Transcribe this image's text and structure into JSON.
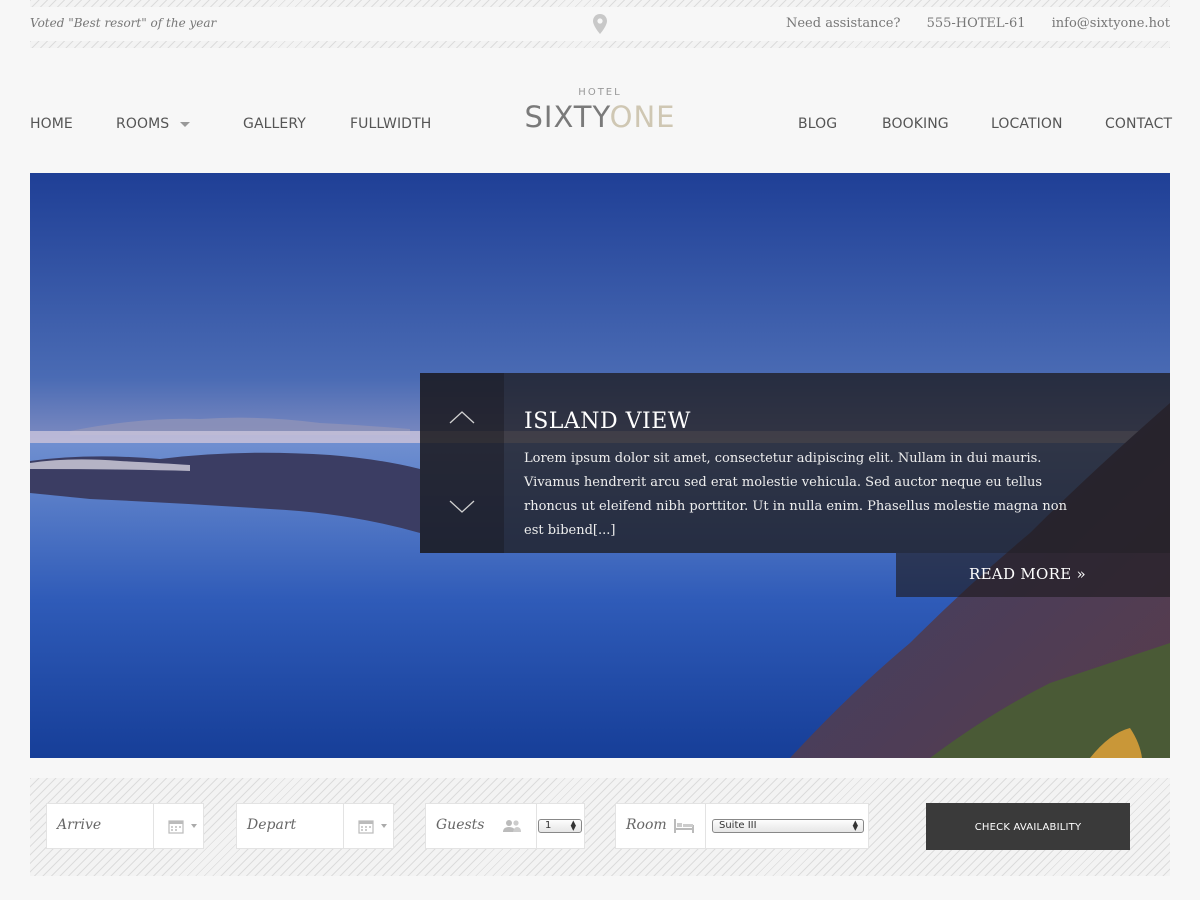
{
  "topbar": {
    "tagline": "Voted \"Best resort\" of the year",
    "assistance": "Need assistance?",
    "phone": "555-HOTEL-61",
    "email": "info@sixtyone.hot"
  },
  "logo": {
    "small": "HOTEL",
    "part1": "SIXTY",
    "part2": "ONE",
    "color1": "#7a7a7a",
    "color2": "#cfc7b3"
  },
  "nav": {
    "left": [
      "HOME",
      "ROOMS",
      "GALLERY",
      "FULLWIDTH"
    ],
    "right": [
      "BLOG",
      "BOOKING",
      "LOCATION",
      "CONTACT"
    ]
  },
  "hero": {
    "title": "ISLAND VIEW",
    "text": "Lorem ipsum dolor sit amet, consectetur adipiscing elit. Nullam in dui mauris. Vivamus hendrerit arcu sed erat molestie vehicula. Sed auctor neque eu tellus rhoncus ut eleifend nibh porttitor. Ut in nulla enim. Phasellus molestie magna non est bibend[...]",
    "read_more": "READ MORE »"
  },
  "booking": {
    "arrive": "Arrive",
    "depart": "Depart",
    "guests_label": "Guests",
    "guests_value": "1",
    "room_label": "Room",
    "room_value": "Suite III",
    "button": "CHECK AVAILABILITY"
  },
  "colors": {
    "background": "#f7f7f7",
    "button": "#3a3a3a",
    "caption_bg": "#1e1c20"
  },
  "icons": [
    "map-pin-icon",
    "calendar-icon",
    "guests-icon",
    "bed-icon",
    "chevron-up-icon",
    "chevron-down-icon"
  ]
}
